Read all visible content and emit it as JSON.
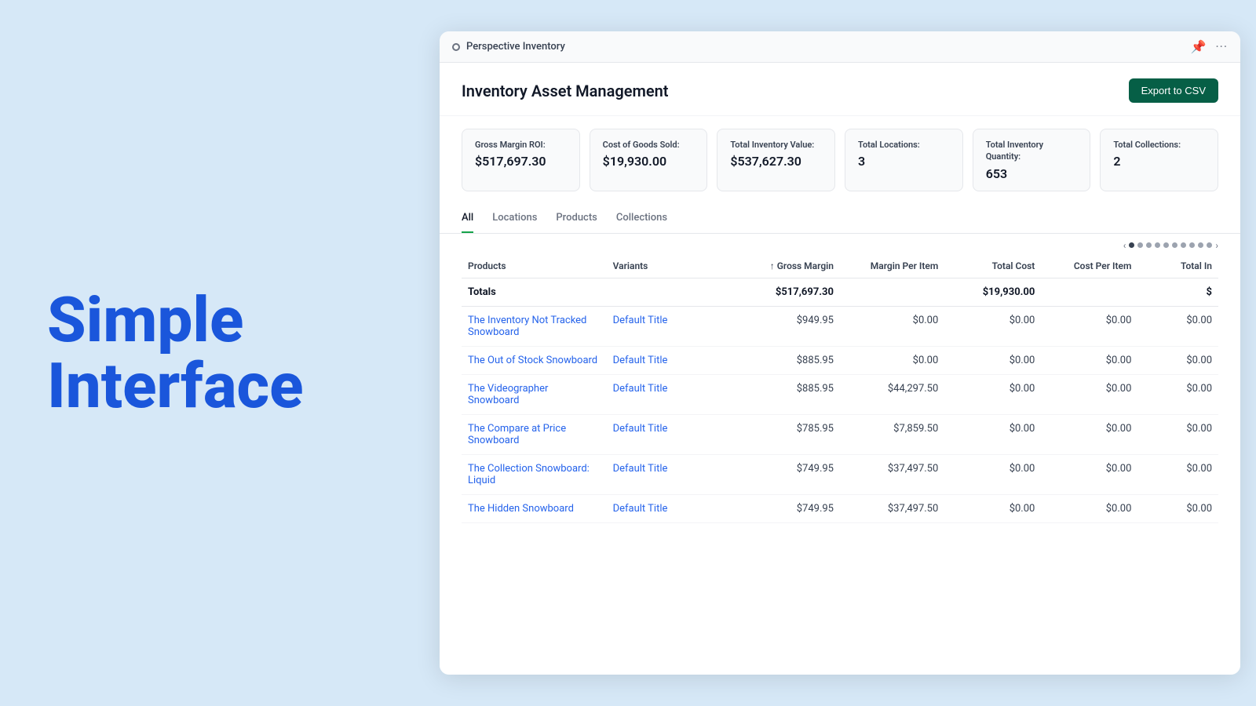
{
  "background": "#d6e8f7",
  "hero": {
    "line1": "Simple",
    "line2": "Interface"
  },
  "titleBar": {
    "title": "Perspective Inventory",
    "pinIcon": "📌",
    "dotsIcon": "···"
  },
  "header": {
    "pageTitle": "Inventory Asset Management",
    "exportButton": "Export to CSV"
  },
  "stats": [
    {
      "label": "Gross Margin ROI:",
      "value": "$517,697.30"
    },
    {
      "label": "Cost of Goods Sold:",
      "value": "$19,930.00"
    },
    {
      "label": "Total Inventory Value:",
      "value": "$537,627.30"
    },
    {
      "label": "Total Locations:",
      "value": "3"
    },
    {
      "label": "Total Inventory Quantity:",
      "value": "653"
    },
    {
      "label": "Total Collections:",
      "value": "2"
    }
  ],
  "tabs": [
    {
      "label": "All",
      "active": true
    },
    {
      "label": "Locations",
      "active": false
    },
    {
      "label": "Products",
      "active": false
    },
    {
      "label": "Collections",
      "active": false
    }
  ],
  "table": {
    "columns": [
      "Products",
      "Variants",
      "↑ Gross Margin",
      "Margin Per Item",
      "Total Cost",
      "Cost Per Item",
      "Total In"
    ],
    "totalsRow": {
      "label": "Totals",
      "grossMargin": "$517,697.30",
      "totalCost": "$19,930.00",
      "totalIn": "$"
    },
    "rows": [
      {
        "product": "The Inventory Not Tracked Snowboard",
        "variant": "Default Title",
        "grossMargin": "$949.95",
        "marginPerItem": "$0.00",
        "totalCost": "$0.00",
        "costPerItem": "$0.00",
        "totalIn": "$0.00"
      },
      {
        "product": "The Out of Stock Snowboard",
        "variant": "Default Title",
        "grossMargin": "$885.95",
        "marginPerItem": "$0.00",
        "totalCost": "$0.00",
        "costPerItem": "$0.00",
        "totalIn": "$0.00"
      },
      {
        "product": "The Videographer Snowboard",
        "variant": "Default Title",
        "grossMargin": "$885.95",
        "marginPerItem": "$44,297.50",
        "totalCost": "$0.00",
        "costPerItem": "$0.00",
        "totalIn": "$0.00"
      },
      {
        "product": "The Compare at Price Snowboard",
        "variant": "Default Title",
        "grossMargin": "$785.95",
        "marginPerItem": "$7,859.50",
        "totalCost": "$0.00",
        "costPerItem": "$0.00",
        "totalIn": "$0.00"
      },
      {
        "product": "The Collection Snowboard: Liquid",
        "variant": "Default Title",
        "grossMargin": "$749.95",
        "marginPerItem": "$37,497.50",
        "totalCost": "$0.00",
        "costPerItem": "$0.00",
        "totalIn": "$0.00"
      },
      {
        "product": "The Hidden Snowboard",
        "variant": "Default Title",
        "grossMargin": "$749.95",
        "marginPerItem": "$37,497.50",
        "totalCost": "$0.00",
        "costPerItem": "$0.00",
        "totalIn": "$0.00"
      }
    ]
  },
  "pagination": {
    "dots": 10,
    "activeDot": 0
  }
}
